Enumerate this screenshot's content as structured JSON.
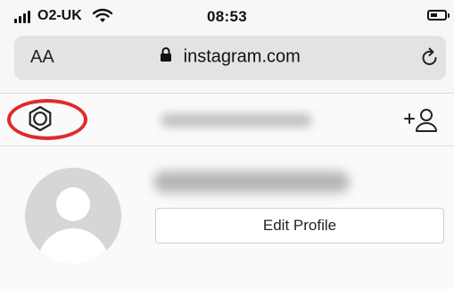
{
  "status_bar": {
    "carrier": "O2-UK",
    "time": "08:53",
    "icons": [
      "signal-icon",
      "wifi-icon",
      "battery-icon"
    ]
  },
  "address_bar": {
    "text_size_label": "AA",
    "url": "instagram.com",
    "icons": [
      "lock-icon",
      "reload-icon"
    ]
  },
  "profile_header": {
    "icons": [
      "settings-gear-icon",
      "add-user-icon"
    ],
    "highlight_color": "#e02a2a"
  },
  "profile": {
    "edit_profile_label": "Edit Profile"
  }
}
